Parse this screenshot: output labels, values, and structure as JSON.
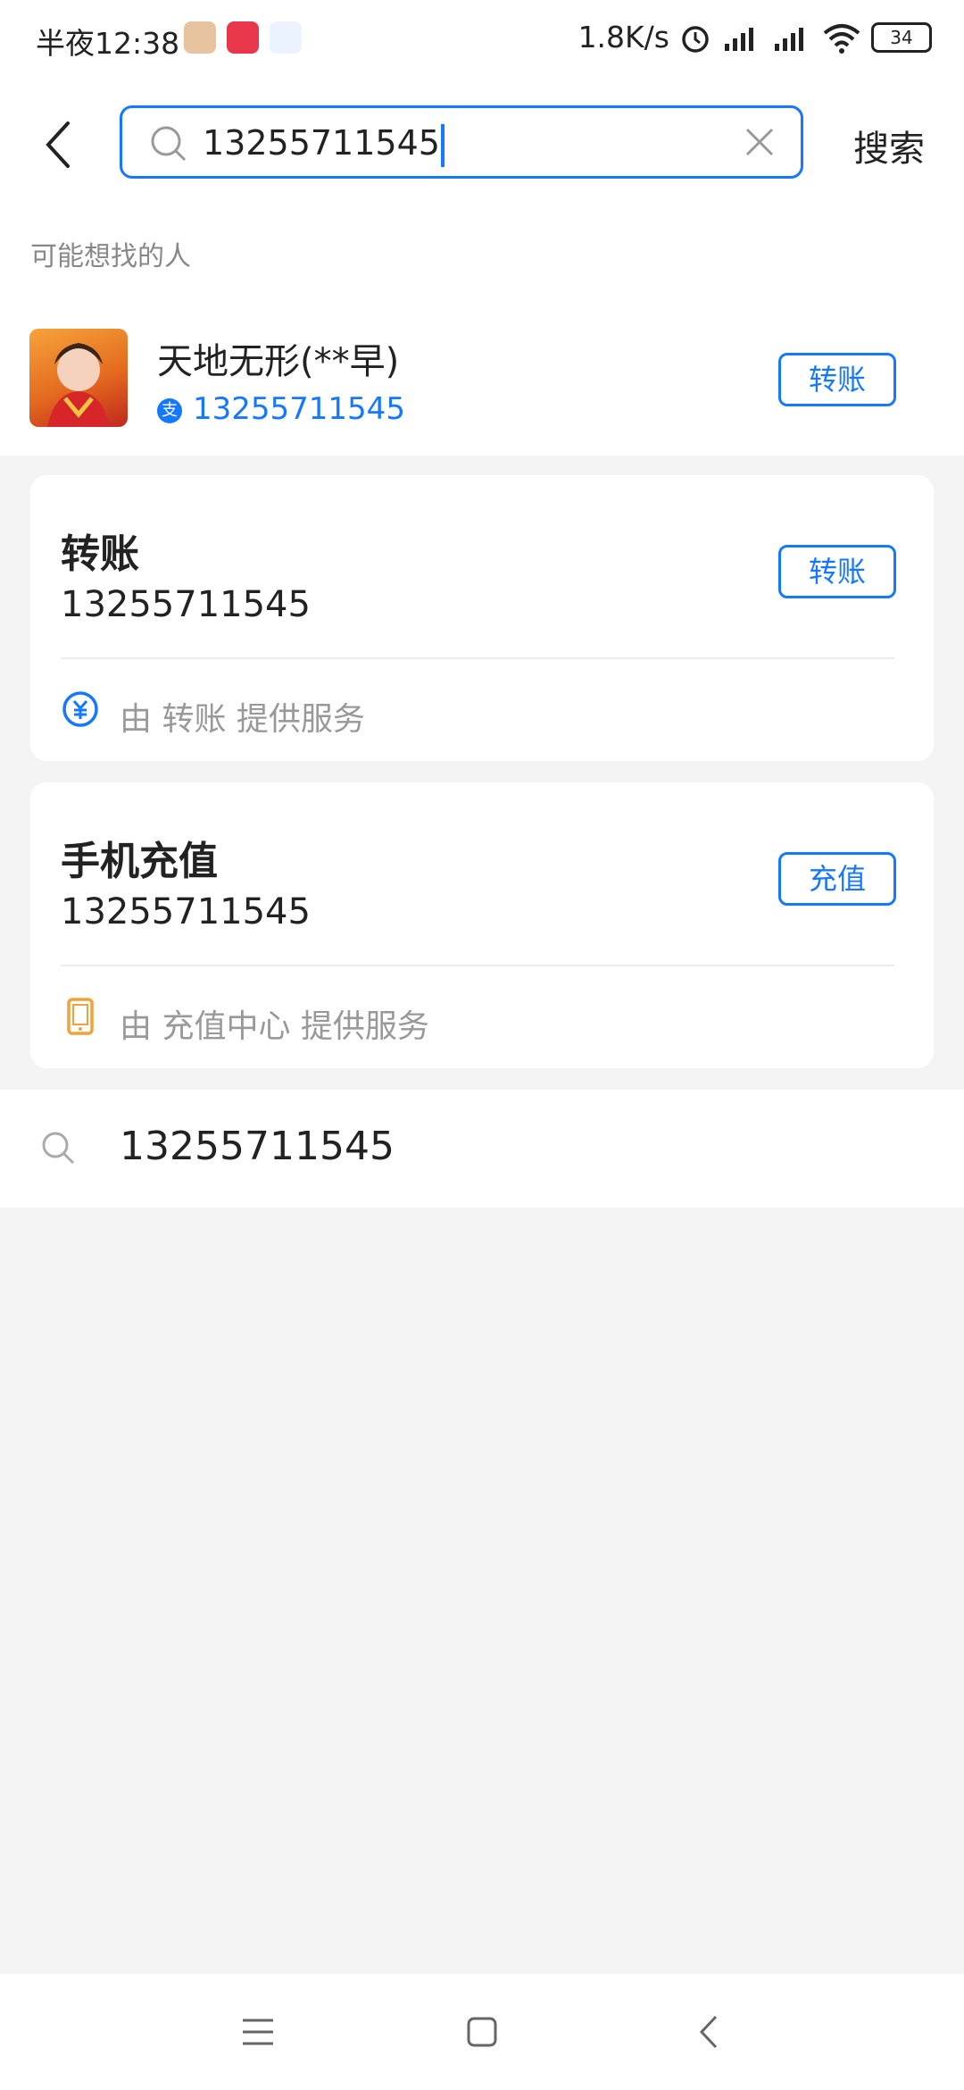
{
  "status_bar": {
    "time": "半夜12:38",
    "network_speed": "1.8K/s",
    "battery": "34",
    "icons": [
      "alarm-icon",
      "signal-hd-icon",
      "signal-hd-icon",
      "wifi-icon",
      "battery-icon"
    ]
  },
  "search": {
    "query": "13255711545",
    "search_button": "搜索"
  },
  "people": {
    "section_title": "可能想找的人",
    "name": "天地无形(**早)",
    "badge": "支",
    "phone": "13255711545",
    "action": "转账"
  },
  "transfer_card": {
    "title": "转账",
    "number": "13255711545",
    "action": "转账",
    "provider": "由 转账 提供服务"
  },
  "recharge_card": {
    "title": "手机充值",
    "number": "13255711545",
    "action": "充值",
    "provider": "由 充值中心 提供服务"
  },
  "suggestion": {
    "text": "13255711545"
  },
  "colors": {
    "accent": "#1677ff",
    "recharge_icon": "#f0a33a"
  }
}
